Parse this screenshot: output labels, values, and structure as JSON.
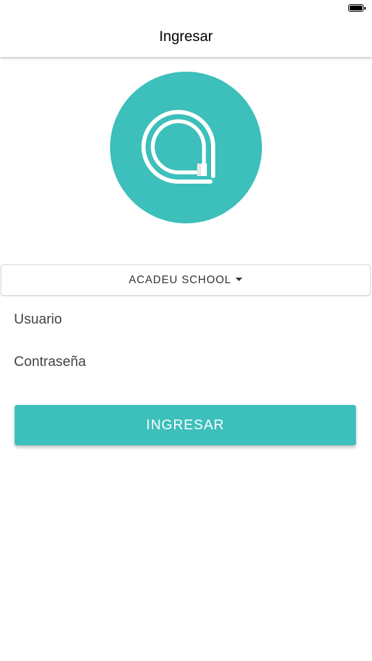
{
  "colors": {
    "accent": "#3dbfbb",
    "header_text": "#000000",
    "body_text": "#333333"
  },
  "status_bar": {
    "battery_icon": "battery-full-icon"
  },
  "header": {
    "title": "Ingresar"
  },
  "logo": {
    "icon": "app-logo-icon"
  },
  "school_select": {
    "selected": "ACADEU SCHOOL",
    "icon": "caret-down-icon"
  },
  "form": {
    "username_placeholder": "Usuario",
    "password_placeholder": "Contraseña",
    "submit_label": "INGRESAR"
  }
}
